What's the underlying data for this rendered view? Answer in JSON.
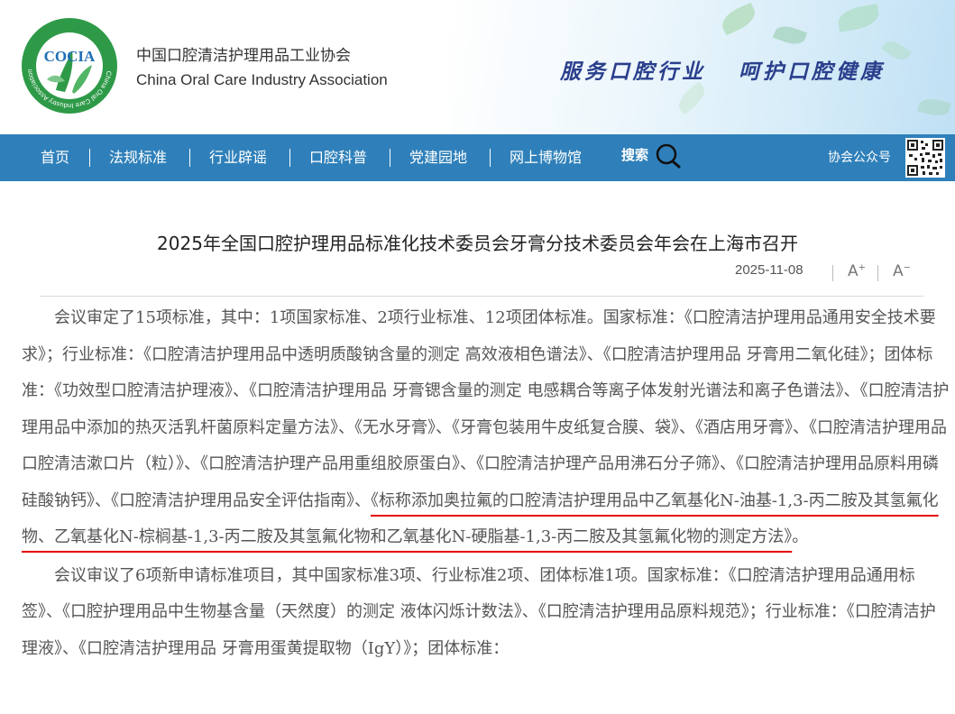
{
  "header": {
    "org_name_cn": "中国口腔清洁护理用品工业协会",
    "org_name_en": "China Oral Care Industry Association",
    "slogan": "服务口腔行业   呵护口腔健康",
    "logo_text": "COCIA",
    "logo_ring_text": "China Oral Care Industry Association"
  },
  "nav": {
    "items": [
      {
        "label": "首页"
      },
      {
        "label": "法规标准"
      },
      {
        "label": "行业辟谣"
      },
      {
        "label": "口腔科普"
      },
      {
        "label": "党建园地"
      },
      {
        "label": "网上博物馆"
      }
    ],
    "search_label": "搜索",
    "wechat_label": "协会公众号"
  },
  "article": {
    "title": "2025年全国口腔护理用品标准化技术委员会牙膏分技术委员会年会在上海市召开",
    "date": "2025-11-08",
    "font_increase": "A",
    "font_decrease": "A",
    "paragraphs": [
      {
        "text": "会议审定了15项标准，其中：1项国家标准、2项行业标准、12项团体标准。国家标准：《口腔清洁护理用品通用安全技术要求》；行业标准：《口腔清洁护理用品中透明质酸钠含量的测定 高效液相色谱法》、《口腔清洁护理用品 牙膏用二氧化硅》；团体标准：《功效型口腔清洁护理液》、《口腔清洁护理用品 牙膏锶含量的测定 电感耦合等离子体发射光谱法和离子色谱法》、《口腔清洁护理用品中添加的热灭活乳杆菌原料定量方法》、《无水牙膏》、《牙膏包装用牛皮纸复合膜、袋》、《酒店用牙膏》、《口腔清洁护理用品　口腔清洁漱口片（粒）》、《口腔清洁护理产品用重组胶原蛋白》、《口腔清洁护理产品用沸石分子筛》、《口腔清洁护理用品原料用磷硅酸钠钙》、《口腔清洁护理用品安全评估指南》、",
        "highlight": "《标称添加奥拉氟的口腔清洁护理用品中乙氧基化N-油基-1,3-丙二胺及其氢氟化物、乙氧基化N-棕榈基-1,3-丙二胺及其氢氟化物和乙氧基化N-硬脂基-1,3-丙二胺及其氢氟化物的测定方法》",
        "tail": "。"
      },
      {
        "text": "会议审议了6项新申请标准项目，其中国家标准3项、行业标准2项、团体标准1项。国家标准：《口腔清洁护理用品通用标签》、《口腔护理用品中生物基含量（天然度）的测定 液体闪烁计数法》、《口腔清洁护理用品原料规范》；行业标准：《口腔清洁护理液》、《口腔清洁护理用品 牙膏用蛋黄提取物（IgY）》；团体标准："
      }
    ]
  },
  "colors": {
    "nav_bg": "#2f80ba",
    "slogan": "#2a3f8c",
    "highlight_underline": "#e60000",
    "logo_green": "#2e9a48",
    "logo_blue": "#1f6fb5"
  }
}
